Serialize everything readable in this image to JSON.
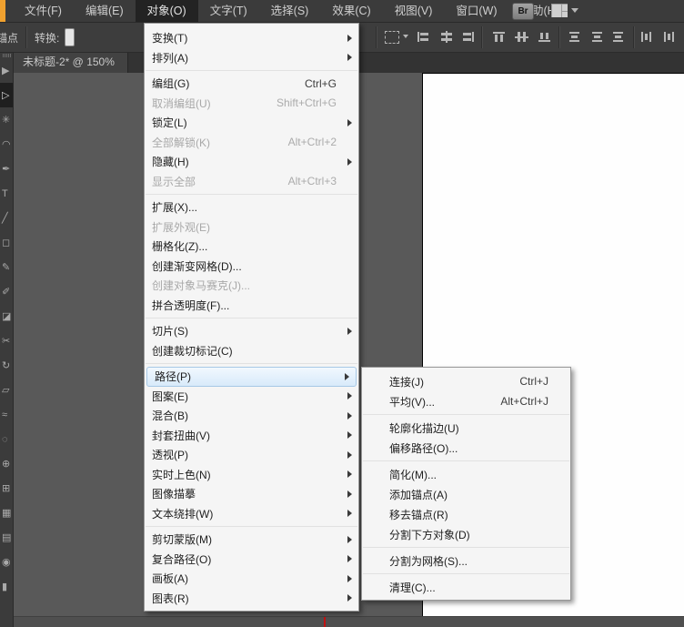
{
  "colors": {
    "menubar_bg": "#3b3b3b",
    "pasteboard": "#595959",
    "canvas": "#fefefe",
    "menu_bg": "#f5f5f5",
    "menu_highlight_bg": "#d8eafa",
    "menu_highlight_border": "#a6c8e6",
    "brand_strip_orange": "#f0a12f",
    "artboard_tick_red": "#c11212"
  },
  "menu_bar": {
    "items": [
      {
        "label": "文件(F)"
      },
      {
        "label": "编辑(E)"
      },
      {
        "label": "对象(O)",
        "active": true
      },
      {
        "label": "文字(T)"
      },
      {
        "label": "选择(S)"
      },
      {
        "label": "效果(C)"
      },
      {
        "label": "视图(V)"
      },
      {
        "label": "窗口(W)"
      },
      {
        "label": "帮助(H)"
      }
    ],
    "bridge_button_label": "Br"
  },
  "control_bar": {
    "anchor_label": "锚点",
    "convert_label": "转换:",
    "align_icons": [
      {
        "name": "align-horizontal-left-icon"
      },
      {
        "name": "align-horizontal-center-icon"
      },
      {
        "name": "align-horizontal-right-icon"
      },
      {
        "name": "align-vertical-top-icon"
      },
      {
        "name": "align-vertical-center-icon"
      },
      {
        "name": "align-vertical-bottom-icon"
      },
      {
        "name": "distribute-vertical-top-icon"
      },
      {
        "name": "distribute-vertical-center-icon"
      },
      {
        "name": "distribute-vertical-bottom-icon"
      },
      {
        "name": "distribute-horizontal-left-icon"
      },
      {
        "name": "distribute-horizontal-center-icon"
      }
    ]
  },
  "tab_bar": {
    "document_tab": "未标题-2* @ 150%"
  },
  "object_menu": {
    "items": [
      {
        "label": "变换(T)",
        "submenu": true
      },
      {
        "label": "排列(A)",
        "submenu": true
      },
      {
        "type": "separator"
      },
      {
        "label": "编组(G)",
        "shortcut": "Ctrl+G"
      },
      {
        "label": "取消编组(U)",
        "shortcut": "Shift+Ctrl+G",
        "disabled": true
      },
      {
        "label": "锁定(L)",
        "submenu": true
      },
      {
        "label": "全部解锁(K)",
        "shortcut": "Alt+Ctrl+2",
        "disabled": true
      },
      {
        "label": "隐藏(H)",
        "submenu": true
      },
      {
        "label": "显示全部",
        "shortcut": "Alt+Ctrl+3",
        "disabled": true
      },
      {
        "type": "separator"
      },
      {
        "label": "扩展(X)..."
      },
      {
        "label": "扩展外观(E)",
        "disabled": true
      },
      {
        "label": "栅格化(Z)..."
      },
      {
        "label": "创建渐变网格(D)..."
      },
      {
        "label": "创建对象马赛克(J)...",
        "disabled": true
      },
      {
        "label": "拼合透明度(F)..."
      },
      {
        "type": "separator"
      },
      {
        "label": "切片(S)",
        "submenu": true
      },
      {
        "label": "创建裁切标记(C)"
      },
      {
        "type": "separator"
      },
      {
        "label": "路径(P)",
        "submenu": true,
        "highlighted": true
      },
      {
        "label": "图案(E)",
        "submenu": true
      },
      {
        "label": "混合(B)",
        "submenu": true
      },
      {
        "label": "封套扭曲(V)",
        "submenu": true
      },
      {
        "label": "透视(P)",
        "submenu": true
      },
      {
        "label": "实时上色(N)",
        "submenu": true
      },
      {
        "label": "图像描摹",
        "submenu": true
      },
      {
        "label": "文本绕排(W)",
        "submenu": true
      },
      {
        "type": "separator"
      },
      {
        "label": "剪切蒙版(M)",
        "submenu": true
      },
      {
        "label": "复合路径(O)",
        "submenu": true
      },
      {
        "label": "画板(A)",
        "submenu": true
      },
      {
        "label": "图表(R)",
        "submenu": true
      }
    ]
  },
  "path_submenu": {
    "items": [
      {
        "label": "连接(J)",
        "shortcut": "Ctrl+J"
      },
      {
        "label": "平均(V)...",
        "shortcut": "Alt+Ctrl+J"
      },
      {
        "type": "separator"
      },
      {
        "label": "轮廓化描边(U)"
      },
      {
        "label": "偏移路径(O)..."
      },
      {
        "type": "separator"
      },
      {
        "label": "简化(M)..."
      },
      {
        "label": "添加锚点(A)"
      },
      {
        "label": "移去锚点(R)"
      },
      {
        "label": "分割下方对象(D)"
      },
      {
        "type": "separator"
      },
      {
        "label": "分割为网格(S)..."
      },
      {
        "type": "separator"
      },
      {
        "label": "清理(C)..."
      }
    ]
  },
  "tools_panel": {
    "tools": [
      {
        "name": "selection-tool-icon",
        "glyph": "▶"
      },
      {
        "name": "direct-selection-tool-icon",
        "glyph": "▷",
        "active": true
      },
      {
        "name": "magic-wand-tool-icon",
        "glyph": "✳"
      },
      {
        "name": "lasso-tool-icon",
        "glyph": "◠"
      },
      {
        "name": "pen-tool-icon",
        "glyph": "✒"
      },
      {
        "name": "type-tool-icon",
        "glyph": "T"
      },
      {
        "name": "line-segment-tool-icon",
        "glyph": "╱"
      },
      {
        "name": "rectangle-tool-icon",
        "glyph": "◻"
      },
      {
        "name": "paintbrush-tool-icon",
        "glyph": "✎"
      },
      {
        "name": "pencil-tool-icon",
        "glyph": "✐"
      },
      {
        "name": "eraser-tool-icon",
        "glyph": "◪"
      },
      {
        "name": "scissors-tool-icon",
        "glyph": "✂"
      },
      {
        "name": "rotate-tool-icon",
        "glyph": "↻"
      },
      {
        "name": "scale-tool-icon",
        "glyph": "▱"
      },
      {
        "name": "width-tool-icon",
        "glyph": "≈"
      },
      {
        "name": "free-transform-tool-icon",
        "glyph": "◌"
      },
      {
        "name": "shape-builder-tool-icon",
        "glyph": "⊕"
      },
      {
        "name": "perspective-grid-tool-icon",
        "glyph": "⊞"
      },
      {
        "name": "mesh-tool-icon",
        "glyph": "▦"
      },
      {
        "name": "gradient-tool-icon",
        "glyph": "▤"
      },
      {
        "name": "blend-tool-icon",
        "glyph": "◉"
      },
      {
        "name": "column-graph-tool-icon",
        "glyph": "▮"
      }
    ]
  }
}
